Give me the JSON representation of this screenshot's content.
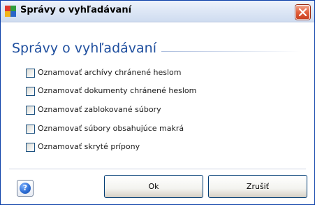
{
  "window": {
    "title": "Správy o vyhľadávaní",
    "icon": "avg-app-icon",
    "close_icon": "close-icon"
  },
  "main": {
    "heading": "Správy o vyhľadávaní",
    "options": [
      {
        "label": "Oznamovať archívy chránené heslom",
        "checked": false
      },
      {
        "label": "Oznamovať dokumenty chránené heslom",
        "checked": false
      },
      {
        "label": "Oznamovať zablokované súbory",
        "checked": false
      },
      {
        "label": "Oznamovať súbory obsahujúce makrá",
        "checked": false
      },
      {
        "label": "Oznamovať skryté prípony",
        "checked": false
      }
    ]
  },
  "footer": {
    "help_icon": "help-icon",
    "ok_label": "Ok",
    "cancel_label": "Zrušiť"
  },
  "colors": {
    "heading": "#1e4e9e",
    "title_bar": "#dfe8f6",
    "close_button": "#e2603c",
    "window_border": "#0b3fa8"
  }
}
